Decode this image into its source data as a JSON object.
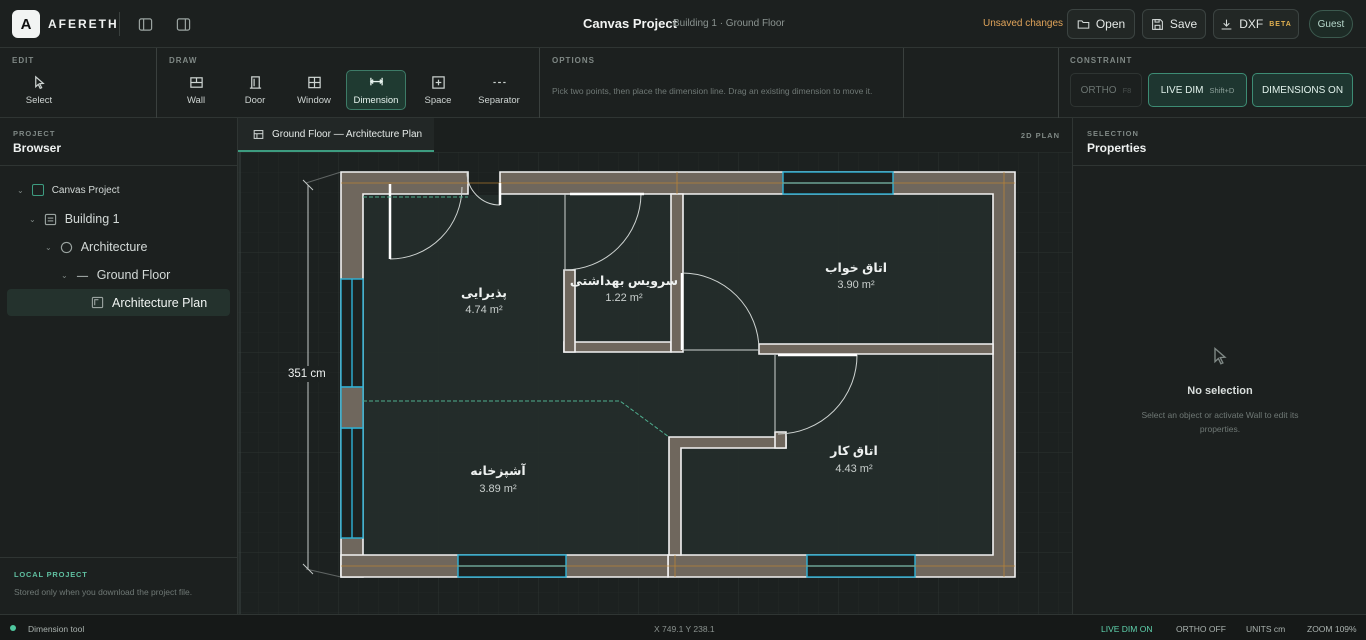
{
  "header": {
    "logo_letter": "A",
    "brand": "AFERETH",
    "title": "Canvas Project",
    "subtitle": "Building 1 · Ground Floor",
    "unsaved": "Unsaved changes",
    "open_label": "Open",
    "save_label": "Save",
    "dxf_label": "DXF",
    "beta_label": "BETA",
    "guest_label": "Guest"
  },
  "toolbar": {
    "edit_label": "EDIT",
    "draw_label": "DRAW",
    "options_label": "OPTIONS",
    "constraint_label": "CONSTRAINT",
    "select_label": "Select",
    "tools": [
      {
        "label": "Wall",
        "icon": "wall-icon"
      },
      {
        "label": "Door",
        "icon": "door-icon"
      },
      {
        "label": "Window",
        "icon": "window-icon"
      },
      {
        "label": "Dimension",
        "icon": "dimension-icon"
      },
      {
        "label": "Space",
        "icon": "space-icon"
      },
      {
        "label": "Separator",
        "icon": "separator-icon"
      }
    ],
    "active_tool": "Dimension",
    "options_text": "Pick two points, then place the dimension line. Drag an existing dimension to move it.",
    "ortho_label": "ORTHO",
    "ortho_key": "F8",
    "live_dim_label": "LIVE DIM",
    "live_dim_key": "Shift+D",
    "dimensions_on_label": "DIMENSIONS ON"
  },
  "left_panel": {
    "section_label": "PROJECT",
    "title": "Browser",
    "tree": [
      {
        "label": "Canvas Project",
        "level": 0,
        "icon": "project-icon"
      },
      {
        "label": "Building 1",
        "level": 1,
        "icon": "building-icon"
      },
      {
        "label": "Architecture",
        "level": 2,
        "icon": "discipline-icon"
      },
      {
        "label": "Ground Floor",
        "level": 3,
        "icon": "floor-icon"
      },
      {
        "label": "Architecture Plan",
        "level": 4,
        "icon": "plan-icon",
        "selected": true
      }
    ],
    "local_label": "LOCAL PROJECT",
    "local_text": "Stored only when you download the project file."
  },
  "canvas": {
    "tab_label": "Ground Floor — Architecture Plan",
    "mode_label": "2D PLAN",
    "dimension_label": "351 cm",
    "rooms": [
      {
        "name": "پذیرایی",
        "area": "4.74 m²"
      },
      {
        "name": "سرویس بهداشتی",
        "area": "1.22 m²"
      },
      {
        "name": "اتاق خواب",
        "area": "3.90 m²"
      },
      {
        "name": "آشپزخانه",
        "area": "3.89 m²"
      },
      {
        "name": "اتاق کار",
        "area": "4.43 m²"
      }
    ]
  },
  "right_panel": {
    "section_label": "SELECTION",
    "title": "Properties",
    "empty_title": "No selection",
    "empty_text": "Select an object or activate Wall to edit its properties."
  },
  "status": {
    "tool_label": "Dimension tool",
    "coords": "X 749.1 Y 238.1",
    "live_dim": "LIVE DIM ON",
    "ortho": "ORTHO OFF",
    "units": "UNITS cm",
    "zoom": "ZOOM 109%"
  },
  "colors": {
    "accent": "#3d9c80",
    "warning": "#e0a45a",
    "window": "#2fb3d8"
  }
}
